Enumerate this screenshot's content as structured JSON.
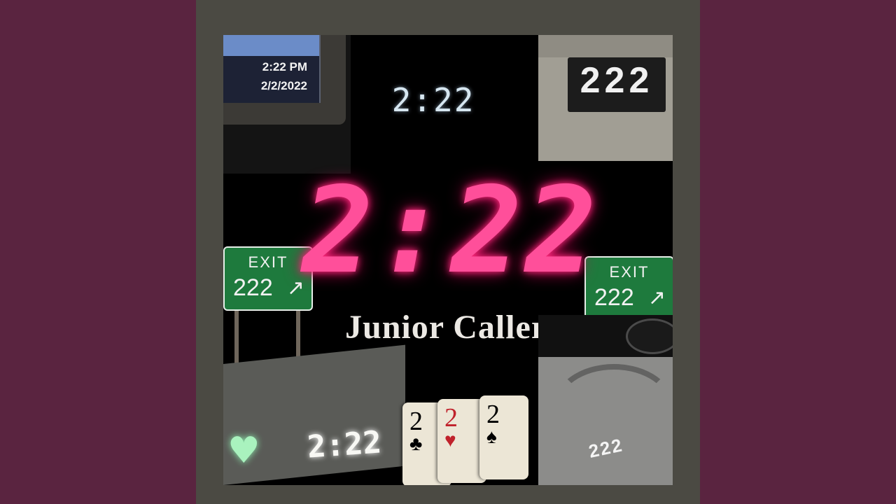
{
  "cover": {
    "artist": "Junior Calleros",
    "main_time": "2:22",
    "monitor_time": "2:22 PM",
    "monitor_date": "2/2/2022",
    "dot_clock": "2:22",
    "curb_number": "222",
    "exit_left": {
      "label": "EXIT",
      "number": "222"
    },
    "exit_right": {
      "label": "EXIT",
      "number": "222"
    },
    "device_time": "2:22",
    "road_text": "222",
    "cards": [
      {
        "rank": "2",
        "suit": "♣",
        "color": "#1a1a1a"
      },
      {
        "rank": "2",
        "suit": "♥",
        "color": "#c0222c"
      },
      {
        "rank": "2",
        "suit": "♠",
        "color": "#1a1a1a"
      }
    ]
  },
  "colors": {
    "background": "#5a2440",
    "frame": "#4b4a43",
    "neon": "#ff4f9a",
    "exit_sign": "#1e7a3d"
  }
}
